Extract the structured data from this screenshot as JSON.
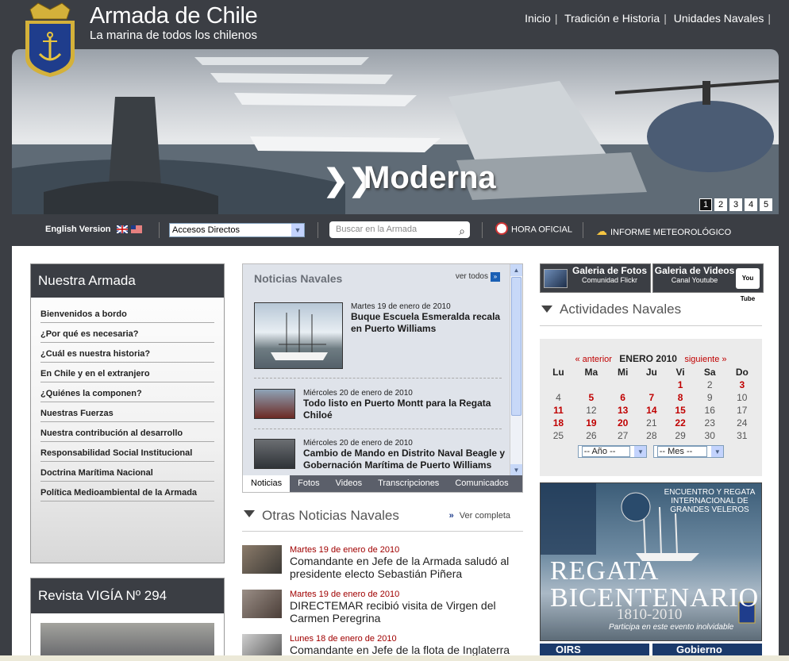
{
  "header": {
    "site_title": "Armada de Chile",
    "site_subtitle": "La marina de todos los chilenos",
    "nav": [
      "Inicio",
      "Tradición e Historia",
      "Unidades Navales"
    ]
  },
  "banner": {
    "slogan": "Moderna",
    "pages": [
      "1",
      "2",
      "3",
      "4",
      "5"
    ],
    "active_page": "1"
  },
  "toolbar": {
    "english": "English Version",
    "accesos_value": "Accesos Directos",
    "search_placeholder": "Buscar en la Armada",
    "hora": "HORA OFICIAL",
    "meteo": "INFORME METEOROLÓGICO"
  },
  "left": {
    "title": "Nuestra Armada",
    "items": [
      "Bienvenidos a bordo",
      "¿Por qué es necesaria?",
      "¿Cuál es nuestra historia?",
      "En Chile y en el extranjero",
      "¿Quiénes la componen?",
      "Nuestras Fuerzas",
      "Nuestra contribución al desarrollo",
      "Responsabilidad Social Institucional",
      "Doctrina Marítima Nacional",
      "Política Medioambiental de la Armada"
    ],
    "vigia_title": "Revista VIGÍA Nº 294"
  },
  "news": {
    "title": "Noticias Navales",
    "ver_todos": "ver todos",
    "items": [
      {
        "date": "Martes 19 de enero de 2010",
        "headline": "Buque Escuela Esmeralda recala en Puerto Williams"
      },
      {
        "date": "Miércoles 20 de enero de 2010",
        "headline": "Todo listo en Puerto Montt para la Regata Chiloé"
      },
      {
        "date": "Miércoles 20 de enero de 2010",
        "headline": "Cambio de Mando en Distrito Naval Beagle y Gobernación Marítima de Puerto Williams"
      }
    ],
    "tabs": [
      "Noticias",
      "Fotos",
      "Videos",
      "Transcripciones",
      "Comunicados"
    ]
  },
  "otras": {
    "title": "Otras Noticias Navales",
    "ver": "Ver completa",
    "items": [
      {
        "date": "Martes 19 de enero de 2010",
        "text": "Comandante en Jefe de la Armada saludó al presidente electo Sebastián Piñera"
      },
      {
        "date": "Martes 19 de enero de 2010",
        "text": "DIRECTEMAR recibió visita de Virgen del Carmen Peregrina"
      },
      {
        "date": "Lunes 18 de enero de 2010",
        "text": "Comandante en Jefe de la flota de Inglaterra"
      }
    ]
  },
  "right": {
    "gal_fotos": "Galeria de Fotos",
    "gal_fotos_sub": "Comunidad Flickr",
    "gal_videos": "Galeria de Videos",
    "gal_videos_sub": "Canal Youtube",
    "youtube": "You Tube",
    "act_title": "Actividades Navales",
    "cal_prev": "« anterior",
    "cal_month": "ENERO 2010",
    "cal_next": "siguiente »",
    "cal_days": [
      "Lu",
      "Ma",
      "Mi",
      "Ju",
      "Vi",
      "Sa",
      "Do"
    ],
    "cal_weeks": [
      [
        "",
        "",
        "",
        "",
        "1",
        "2",
        "3"
      ],
      [
        "4",
        "5",
        "6",
        "7",
        "8",
        "9",
        "10"
      ],
      [
        "11",
        "12",
        "13",
        "14",
        "15",
        "16",
        "17"
      ],
      [
        "18",
        "19",
        "20",
        "21",
        "22",
        "23",
        "24"
      ],
      [
        "25",
        "26",
        "27",
        "28",
        "29",
        "30",
        "31"
      ]
    ],
    "cal_events": [
      "1",
      "3",
      "5",
      "6",
      "7",
      "8",
      "11",
      "13",
      "14",
      "15",
      "18",
      "19",
      "20",
      "22"
    ],
    "year_sel": "-- Año --",
    "month_sel": "-- Mes --",
    "regata_top": "ENCUENTRO Y REGATA INTERNACIONAL DE GRANDES VELEROS",
    "regata_main": "REGATA BICENTENARIO",
    "regata_years": "1810-2010",
    "regata_sub": "Participa en este evento inolvidable",
    "banner_a": "OIRS",
    "banner_b": "Gobierno"
  },
  "colors": {
    "dark": "#3b3e44",
    "event_red": "#c00000",
    "news_bg": "#dfe3ea"
  }
}
